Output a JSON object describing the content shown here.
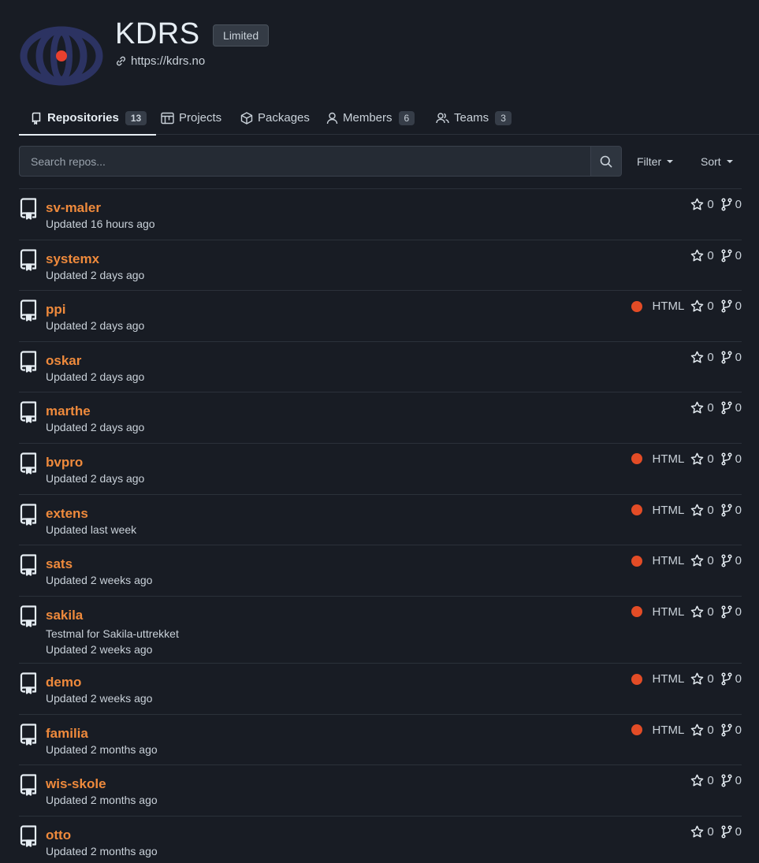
{
  "org": {
    "name": "KDRS",
    "badge": "Limited",
    "url": "https://kdrs.no",
    "avatar_colors": {
      "ring": "#2c3362",
      "dot": "#e8402e"
    }
  },
  "tabs": [
    {
      "label": "Repositories",
      "count": "13",
      "icon": "repo-icon",
      "active": true
    },
    {
      "label": "Projects",
      "icon": "project-icon"
    },
    {
      "label": "Packages",
      "icon": "package-icon"
    },
    {
      "label": "Members",
      "count": "6",
      "icon": "person-icon"
    },
    {
      "label": "Teams",
      "count": "3",
      "icon": "people-icon"
    }
  ],
  "search": {
    "placeholder": "Search repos..."
  },
  "filters": {
    "filter_label": "Filter",
    "sort_label": "Sort"
  },
  "colors": {
    "repo_link": "#ef8a3c",
    "html_lang": "#e34c26",
    "background": "#181c24"
  },
  "repos": [
    {
      "name": "sv-maler",
      "updated": "Updated 16 hours ago",
      "stars": "0",
      "forks": "0"
    },
    {
      "name": "systemx",
      "updated": "Updated 2 days ago",
      "stars": "0",
      "forks": "0"
    },
    {
      "name": "ppi",
      "updated": "Updated 2 days ago",
      "language": "HTML",
      "stars": "0",
      "forks": "0"
    },
    {
      "name": "oskar",
      "updated": "Updated 2 days ago",
      "stars": "0",
      "forks": "0"
    },
    {
      "name": "marthe",
      "updated": "Updated 2 days ago",
      "stars": "0",
      "forks": "0"
    },
    {
      "name": "bvpro",
      "updated": "Updated 2 days ago",
      "language": "HTML",
      "stars": "0",
      "forks": "0"
    },
    {
      "name": "extens",
      "updated": "Updated last week",
      "language": "HTML",
      "stars": "0",
      "forks": "0"
    },
    {
      "name": "sats",
      "updated": "Updated 2 weeks ago",
      "language": "HTML",
      "stars": "0",
      "forks": "0"
    },
    {
      "name": "sakila",
      "description": "Testmal for Sakila-uttrekket",
      "updated": "Updated 2 weeks ago",
      "language": "HTML",
      "stars": "0",
      "forks": "0"
    },
    {
      "name": "demo",
      "updated": "Updated 2 weeks ago",
      "language": "HTML",
      "stars": "0",
      "forks": "0"
    },
    {
      "name": "familia",
      "updated": "Updated 2 months ago",
      "language": "HTML",
      "stars": "0",
      "forks": "0"
    },
    {
      "name": "wis-skole",
      "updated": "Updated 2 months ago",
      "stars": "0",
      "forks": "0"
    },
    {
      "name": "otto",
      "updated": "Updated 2 months ago",
      "stars": "0",
      "forks": "0"
    }
  ]
}
